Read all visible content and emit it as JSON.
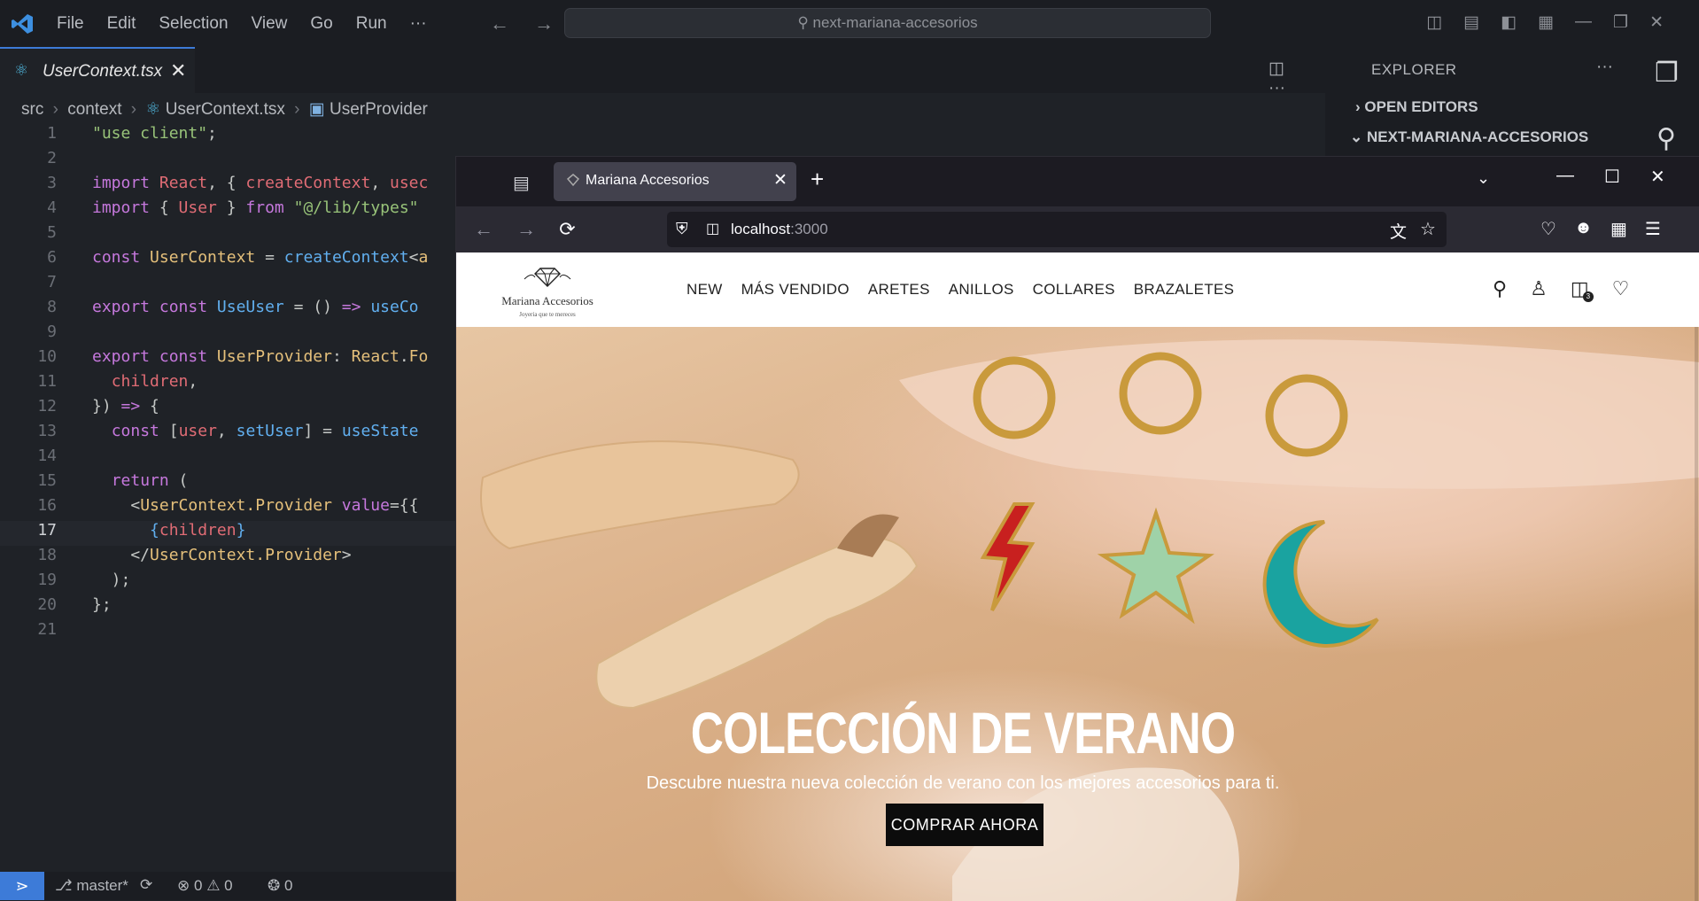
{
  "vscode": {
    "menu": [
      "File",
      "Edit",
      "Selection",
      "View",
      "Go",
      "Run",
      "···"
    ],
    "search_text": "next-mariana-accesorios",
    "tab": {
      "label": "UserContext.tsx",
      "close": "✕"
    },
    "breadcrumb": [
      "src",
      "context",
      "UserContext.tsx",
      "UserProvider"
    ],
    "line_numbers": [
      "1",
      "2",
      "3",
      "4",
      "5",
      "6",
      "7",
      "8",
      "9",
      "10",
      "11",
      "12",
      "13",
      "14",
      "15",
      "16",
      "17",
      "18",
      "19",
      "20",
      "21"
    ],
    "active_line": "17",
    "explorer": {
      "title": "EXPLORER",
      "more": "···",
      "open_editors": "OPEN EDITORS",
      "project": "NEXT-MARIANA-ACCESORIOS"
    },
    "status": {
      "branch": "master*",
      "errors": "0",
      "warnings": "0",
      "ports": "0"
    }
  },
  "browser": {
    "tab_title": "Mariana Accesorios",
    "url_host": "localhost",
    "url_port": ":3000"
  },
  "site": {
    "logo_name": "Mariana Accesorios",
    "logo_tagline": "Joyeria que te mereces",
    "nav": [
      "NEW",
      "MÁS VENDIDO",
      "ARETES",
      "ANILLOS",
      "COLLARES",
      "BRAZALETES"
    ],
    "cart_count": "3",
    "hero": {
      "title": "COLECCIÓN DE VERANO",
      "subtitle": "Descubre nuestra nueva colección de verano con los mejores accesorios para ti.",
      "cta": "COMPRAR AHORA"
    }
  }
}
